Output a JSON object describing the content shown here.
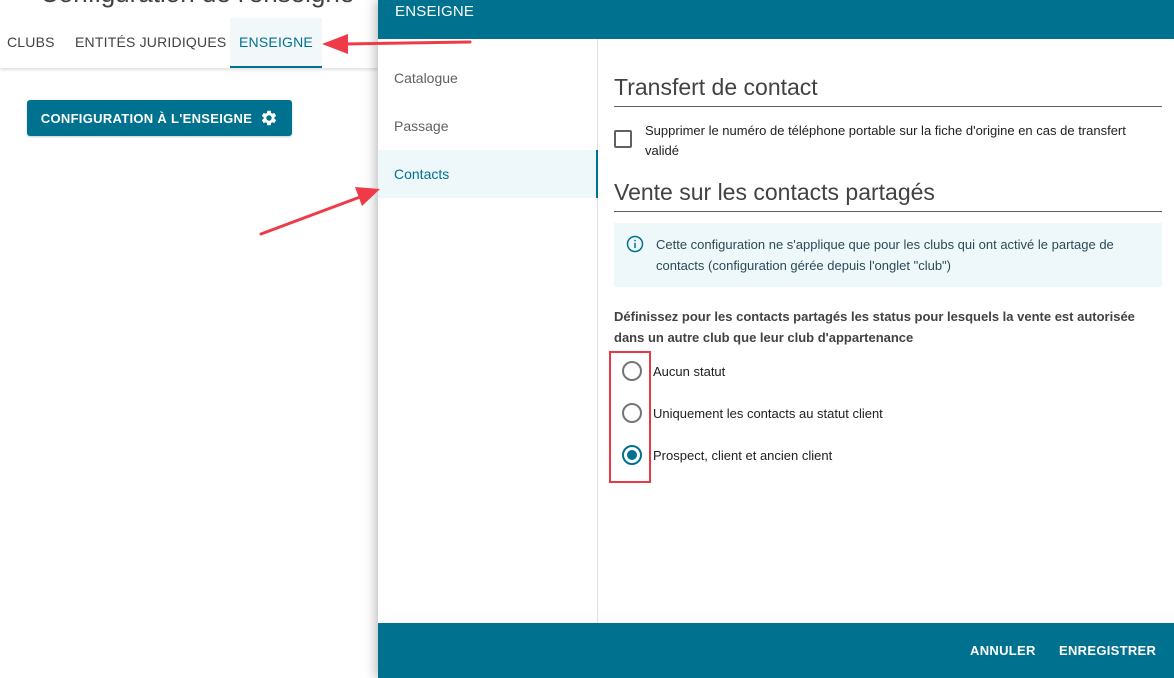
{
  "background": {
    "title": "Configuration de l'enseigne",
    "tabs": [
      {
        "label": "CLUBS"
      },
      {
        "label": "ENTITÉS JURIDIQUES"
      },
      {
        "label": "ENSEIGNE",
        "active": true
      }
    ],
    "config_button": {
      "label": "CONFIGURATION À L'ENSEIGNE",
      "icon": "gear-icon"
    }
  },
  "drawer": {
    "title": "ENSEIGNE",
    "nav": [
      {
        "label": "Catalogue"
      },
      {
        "label": "Passage"
      },
      {
        "label": "Contacts",
        "active": true
      }
    ],
    "transfer": {
      "title": "Transfert de contact",
      "checkbox_label": "Supprimer le numéro de téléphone portable sur la fiche d'origine en cas de transfert validé",
      "checked": false
    },
    "shared_sales": {
      "title": "Vente sur les contacts partagés",
      "info_icon": "info-icon",
      "info_text": "Cette configuration ne s'applique que pour les clubs qui ont activé le partage de contacts (configuration gérée depuis l'onglet \"club\")",
      "question": "Définissez pour les contacts partagés les status pour lesquels la vente est autorisée dans un autre club que leur club d'appartenance",
      "options": [
        {
          "label": "Aucun statut",
          "selected": false
        },
        {
          "label": "Uniquement les contacts au statut client",
          "selected": false
        },
        {
          "label": "Prospect, client et ancien client",
          "selected": true
        }
      ]
    },
    "footer": {
      "cancel_label": "ANNULER",
      "save_label": "ENREGISTRER"
    }
  },
  "colors": {
    "primary": "#00718f",
    "active_bg": "#eef8fa",
    "annotation_red": "#e53946"
  }
}
